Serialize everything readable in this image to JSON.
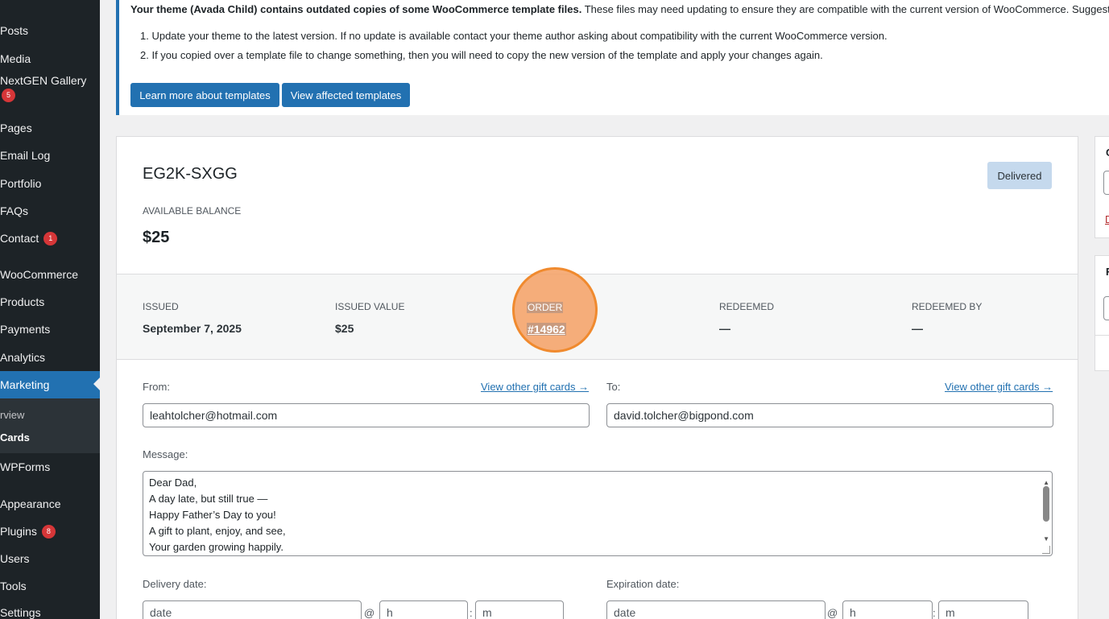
{
  "sidebar": {
    "items": [
      {
        "label": "Posts"
      },
      {
        "label": "Media"
      },
      {
        "label": "NextGEN Gallery",
        "badge": "5"
      },
      {
        "label": "Pages"
      },
      {
        "label": "Email Log"
      },
      {
        "label": "Portfolio"
      },
      {
        "label": "FAQs"
      },
      {
        "label": "Contact",
        "badge": "1"
      },
      {
        "label": "WooCommerce"
      },
      {
        "label": "Products"
      },
      {
        "label": "Payments"
      },
      {
        "label": "Analytics"
      },
      {
        "label": "Marketing"
      },
      {
        "label": "WPForms"
      },
      {
        "label": "Appearance"
      },
      {
        "label": "Plugins",
        "badge": "8"
      },
      {
        "label": "Users"
      },
      {
        "label": "Tools"
      },
      {
        "label": "Settings"
      }
    ],
    "submenu": [
      {
        "label": "rview"
      },
      {
        "label": "Cards"
      }
    ]
  },
  "notice": {
    "bold": "Your theme (Avada Child) contains outdated copies of some WooCommerce template files.",
    "rest": " These files may need updating to ensure they are compatible with the current version of WooCommerce. Suggestions",
    "steps": [
      "1. Update your theme to the latest version. If no update is available contact your theme author asking about compatibility with the current WooCommerce version.",
      "2. If you copied over a template file to change something, then you will need to copy the new version of the template and apply your changes again."
    ],
    "learn_btn": "Learn more about templates",
    "view_btn": "View affected templates"
  },
  "giftcard": {
    "code": "EG2K-SXGG",
    "status": "Delivered",
    "balance_label": "AVAILABLE BALANCE",
    "balance": "$25",
    "stats": {
      "issued_label": "ISSUED",
      "issued": "September 7, 2025",
      "issued_value_label": "ISSUED VALUE",
      "issued_value": "$25",
      "order_label": "ORDER",
      "order": "#14962",
      "redeemed_label": "REDEEMED",
      "redeemed": "—",
      "redeemed_by_label": "REDEEMED BY",
      "redeemed_by": "—"
    },
    "from_label": "From:",
    "from_link": "View other gift cards →",
    "from_value": "leahtolcher@hotmail.com",
    "to_label": "To:",
    "to_link": "View other gift cards →",
    "to_value": "david.tolcher@bigpond.com",
    "message_label": "Message:",
    "message_lines": [
      "Dear Dad,",
      "A day late, but still true —",
      "Happy Father’s Day to you!",
      "A gift to plant, enjoy, and see,",
      "Your garden growing happily."
    ],
    "delivery_label": "Delivery date:",
    "expiration_label": "Expiration date:",
    "date_placeholder": "date",
    "hour_placeholder": "h",
    "minute_placeholder": "m",
    "at_sign": "@",
    "colon": ":"
  },
  "side": {
    "top_char": "C",
    "link_char": "D",
    "bottom_char": "F"
  },
  "colors": {
    "sidebar_bg": "#1d2327",
    "accent": "#2271b1",
    "badge": "#d63638",
    "highlight": "#f08a2e"
  }
}
